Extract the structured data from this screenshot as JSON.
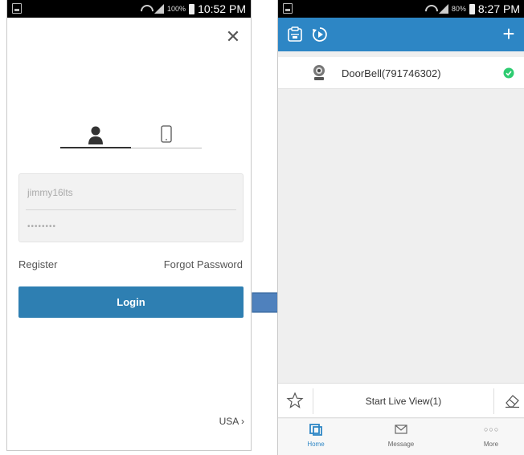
{
  "left_status": {
    "battery": "100%",
    "time": "10:52 PM"
  },
  "right_status": {
    "battery": "80%",
    "time": "8:27 PM"
  },
  "login": {
    "username_value": "jimmy16lts",
    "password_value": "••••••••",
    "register_label": "Register",
    "forgot_label": "Forgot Password",
    "login_label": "Login",
    "region_label": "USA"
  },
  "home": {
    "device_name": "DoorBell(791746302)",
    "start_live_label": "Start Live View(1)",
    "nav": {
      "home_label": "Home",
      "message_label": "Message",
      "more_label": "More"
    }
  },
  "colors": {
    "accent": "#2d86c5",
    "login_button": "#2e7fb2",
    "status_ok": "#2ecc71",
    "arrow": "#4f81bd"
  },
  "icons": [
    "close-icon",
    "person-icon",
    "phone-icon",
    "clipboard-icon",
    "playback-icon",
    "add-icon",
    "camera-icon",
    "check-circle-icon",
    "star-icon",
    "eraser-icon",
    "home-icon",
    "message-icon",
    "more-icon"
  ]
}
